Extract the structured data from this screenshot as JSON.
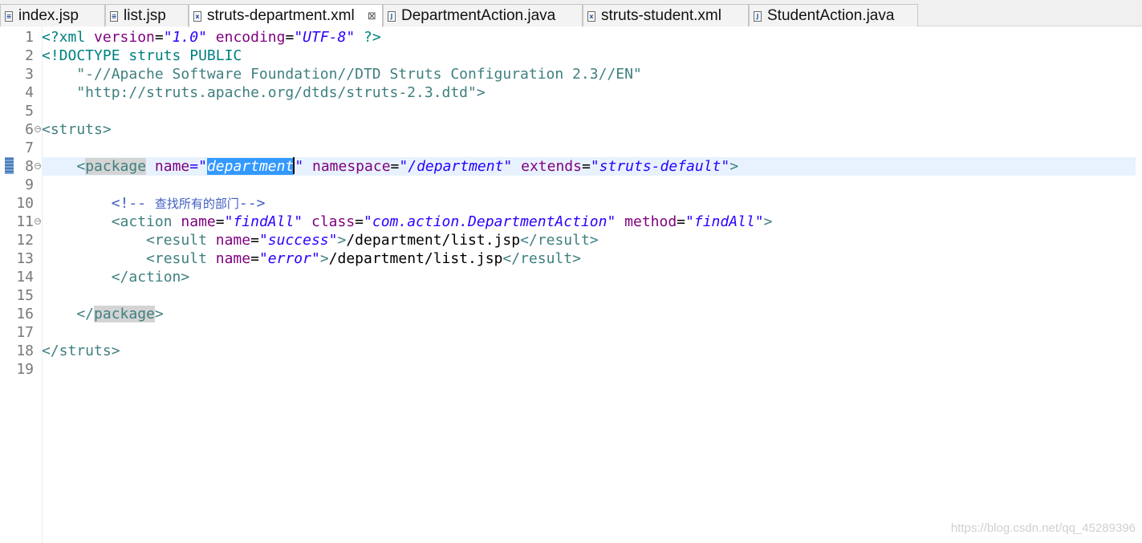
{
  "tabs": [
    {
      "label": "index.jsp",
      "icon": "jsp-file-icon",
      "active": false
    },
    {
      "label": "list.jsp",
      "icon": "jsp-file-icon",
      "active": false
    },
    {
      "label": "struts-department.xml",
      "icon": "xml-file-icon",
      "active": true,
      "close": "⊠"
    },
    {
      "label": "DepartmentAction.java",
      "icon": "java-file-icon",
      "active": false
    },
    {
      "label": "struts-student.xml",
      "icon": "xml-file-icon",
      "active": false
    },
    {
      "label": "StudentAction.java",
      "icon": "java-file-icon",
      "active": false
    }
  ],
  "editor": {
    "current_line": 8,
    "lines": [
      {
        "n": "1"
      },
      {
        "n": "2"
      },
      {
        "n": "3"
      },
      {
        "n": "4"
      },
      {
        "n": "5"
      },
      {
        "n": "6",
        "fold": true
      },
      {
        "n": "7"
      },
      {
        "n": "8",
        "fold": true
      },
      {
        "n": "9"
      },
      {
        "n": "10"
      },
      {
        "n": "11",
        "fold": true
      },
      {
        "n": "12"
      },
      {
        "n": "13"
      },
      {
        "n": "14"
      },
      {
        "n": "15"
      },
      {
        "n": "16"
      },
      {
        "n": "17"
      },
      {
        "n": "18"
      },
      {
        "n": "19"
      }
    ],
    "code": {
      "l1": {
        "a": "<?xml ",
        "b": "version",
        "c": "=",
        "d": "\"1.0\"",
        "e": " ",
        "f": "encoding",
        "g": "=",
        "h": "\"UTF-8\"",
        "i": " ?>"
      },
      "l2": {
        "a": "<!DOCTYPE struts PUBLIC"
      },
      "l3": {
        "a": "    \"-//Apache Software Foundation//DTD Struts Configuration 2.3//EN\""
      },
      "l4": {
        "a": "    \"http://struts.apache.org/dtds/struts-2.3.dtd\">"
      },
      "l6": {
        "a": "<struts>"
      },
      "l8": {
        "a": "    <",
        "b": "package",
        "c": " ",
        "d": "name",
        "e": "=\"",
        "f": "department",
        "g": "\" ",
        "h": "namespace",
        "i": "=",
        "j": "\"/department\"",
        "k": " ",
        "l": "extends",
        "m": "=",
        "n": "\"struts-default\"",
        "o": ">"
      },
      "l10": {
        "a": "        <!-- ",
        "b": "查找所有的部门",
        "c": "-->"
      },
      "l11": {
        "a": "        <action ",
        "b": "name",
        "c": "=",
        "d": "\"findAll\"",
        "e": " ",
        "f": "class",
        "g": "=",
        "h": "\"com.action.DepartmentAction\"",
        "i": " ",
        "j": "method",
        "k": "=",
        "l": "\"findAll\"",
        "m": ">"
      },
      "l12": {
        "a": "            <result ",
        "b": "name",
        "c": "=",
        "d": "\"success\"",
        "e": ">",
        "f": "/department/list.jsp",
        "g": "</result>"
      },
      "l13": {
        "a": "            <result ",
        "b": "name",
        "c": "=",
        "d": "\"error\"",
        "e": ">",
        "f": "/department/list.jsp",
        "g": "</result>"
      },
      "l14": {
        "a": "        </action>"
      },
      "l16": {
        "a": "    </",
        "b": "package",
        "c": ">"
      },
      "l18": {
        "a": "</struts>"
      }
    }
  },
  "watermark": "https://blog.csdn.net/qq_45289396",
  "colors": {
    "tag": "#3f7f7f",
    "attribute": "#7f007f",
    "value": "#2a00ff",
    "comment": "#3f5fbf",
    "selection": "#3399ff",
    "current_line": "#e8f2fe"
  }
}
